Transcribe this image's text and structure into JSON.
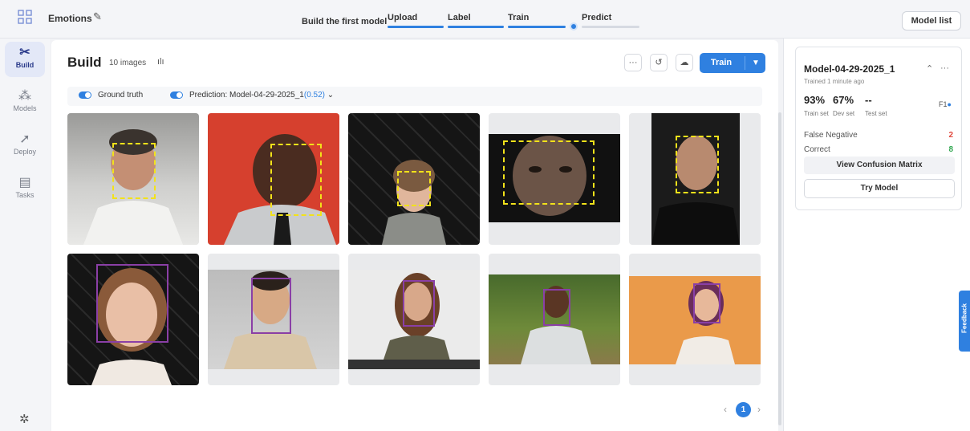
{
  "header": {
    "project_name": "Emotions",
    "build_first_label": "Build the first model",
    "steps": [
      {
        "label": "Upload",
        "status": "done"
      },
      {
        "label": "Label",
        "status": "done"
      },
      {
        "label": "Train",
        "status": "done"
      },
      {
        "label": "Predict",
        "status": "current"
      }
    ],
    "model_list_label": "Model list"
  },
  "nav": {
    "items": [
      {
        "label": "Build",
        "icon": "build-icon",
        "active": true
      },
      {
        "label": "Models",
        "icon": "models-icon",
        "active": false
      },
      {
        "label": "Deploy",
        "icon": "rocket-icon",
        "active": false
      },
      {
        "label": "Tasks",
        "icon": "tasks-icon",
        "active": false
      }
    ],
    "settings_icon": "gear-icon"
  },
  "build": {
    "title": "Build",
    "image_count": "10 images",
    "toolbar": {
      "more_icon": "ellipsis-icon",
      "history_icon": "history-icon",
      "cloud_icon": "cloud-upload-icon",
      "train_label": "Train"
    },
    "toggles": {
      "ground_truth_label": "Ground truth",
      "prediction_label": "Prediction: Model-04-29-2025_1",
      "prediction_score": "(0.52)"
    },
    "images": [
      {
        "name": "image-1",
        "box_type": "ground-truth"
      },
      {
        "name": "image-2",
        "box_type": "ground-truth"
      },
      {
        "name": "image-3",
        "box_type": "ground-truth"
      },
      {
        "name": "image-4",
        "box_type": "ground-truth"
      },
      {
        "name": "image-5",
        "box_type": "ground-truth"
      },
      {
        "name": "image-6",
        "box_type": "prediction"
      },
      {
        "name": "image-7",
        "box_type": "prediction"
      },
      {
        "name": "image-8",
        "box_type": "prediction"
      },
      {
        "name": "image-9",
        "box_type": "prediction"
      },
      {
        "name": "image-10",
        "box_type": "prediction"
      }
    ],
    "pagination": {
      "current_page": "1"
    }
  },
  "model_card": {
    "name": "Model-04-29-2025_1",
    "trained": "Trained 1 minute ago",
    "metrics": [
      {
        "value": "93%",
        "label": "Train set"
      },
      {
        "value": "67%",
        "label": "Dev set"
      },
      {
        "value": "--",
        "label": "Test set"
      }
    ],
    "f1_label": "F1",
    "rows": [
      {
        "label": "False Negative",
        "value": "2",
        "color": "#e0463b"
      },
      {
        "label": "Correct",
        "value": "8",
        "color": "#34a853"
      }
    ],
    "confusion_matrix_label": "View Confusion Matrix",
    "try_model_label": "Try Model"
  },
  "feedback_label": "Feedback",
  "colors": {
    "accent": "#2f80e0",
    "ground_truth_box": "#f2e21a",
    "prediction_box": "#8a3fa6"
  }
}
